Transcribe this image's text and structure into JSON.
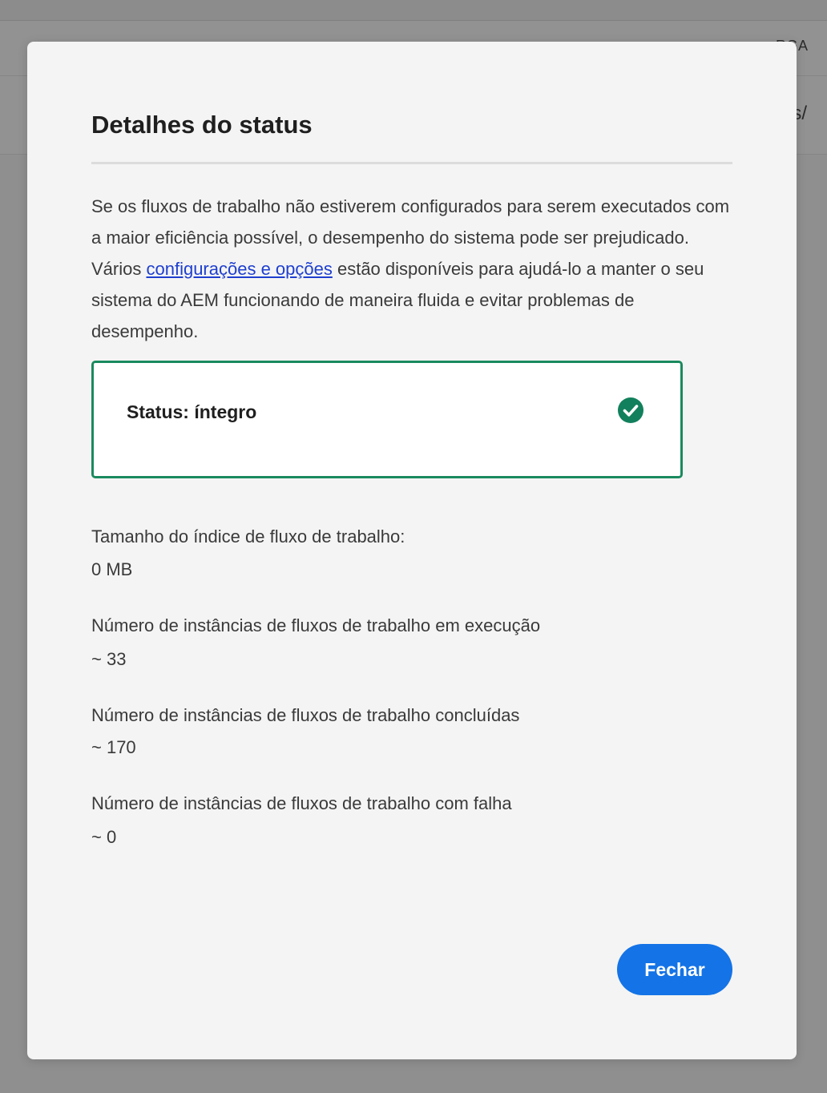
{
  "background": {
    "toolbar_fragment": "RGA",
    "row_fragment": "ps/"
  },
  "dialog": {
    "title": "Detalhes do status",
    "description_before_link": "Se os fluxos de trabalho não estiverem configurados para serem executados com a maior eficiência possível, o desempenho do sistema pode ser prejudicado. Vários ",
    "description_link": "configurações e opções",
    "description_after_link": " estão disponíveis para ajudá-lo a manter o seu sistema do AEM funcionando de maneira fluida e evitar problemas de desempenho.",
    "status": {
      "label": "Status: íntegro",
      "icon": "check-circle-icon",
      "color": "#12805c"
    },
    "metrics": [
      {
        "label": "Tamanho do índice de fluxo de trabalho:",
        "value": "0 MB"
      },
      {
        "label": "Número de instâncias de fluxos de trabalho em execução",
        "value": "~ 33"
      },
      {
        "label": "Número de instâncias de fluxos de trabalho concluídas",
        "value": "~ 170"
      },
      {
        "label": "Número de instâncias de fluxos de trabalho com falha",
        "value": "~ 0"
      }
    ],
    "close_label": "Fechar"
  },
  "colors": {
    "accent": "#1473e6",
    "status_border": "#1a8a5e",
    "link": "#1e3fcf"
  }
}
